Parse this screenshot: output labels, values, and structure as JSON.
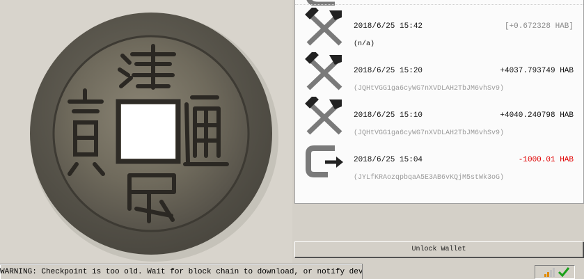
{
  "transactions": [
    {
      "icon": "pickaxe-hammer-icon",
      "datetime": "2018/6/25 15:42",
      "amount": "[+0.672328 HAB]",
      "amount_style": "pending",
      "address": "(n/a)",
      "address_style": "dark"
    },
    {
      "icon": "pickaxe-hammer-icon",
      "datetime": "2018/6/25 15:20",
      "amount": "+4037.793749 HAB",
      "amount_style": "normal",
      "address": "(JQHtVGG1ga6cyWG7nXVDLAH2TbJM6vhSv9)",
      "address_style": "grey"
    },
    {
      "icon": "pickaxe-hammer-icon",
      "datetime": "2018/6/25 15:10",
      "amount": "+4040.240798 HAB",
      "amount_style": "normal",
      "address": "(JQHtVGG1ga6cyWG7nXVDLAH2TbJM6vhSv9)",
      "address_style": "grey"
    },
    {
      "icon": "send-arrow-icon",
      "datetime": "2018/6/25 15:04",
      "amount": "-1000.01 HAB",
      "amount_style": "negative",
      "address": "(JYLfKRAozqpbqaA5E3AB6vKQjM5stWk3oG)",
      "address_style": "grey"
    }
  ],
  "unlock_button": {
    "label": "Unlock Wallet"
  },
  "status_bar": {
    "warning": "WARNING: Checkpoint is too old. Wait for block chain to download, or notify developers.",
    "icons": [
      "signal-bars-icon",
      "synced-check-icon"
    ]
  },
  "colors": {
    "negative": "#e00000",
    "pending": "#8a8a8a",
    "icon_grey": "#7a7a7a",
    "synced_green": "#1aa01a"
  }
}
